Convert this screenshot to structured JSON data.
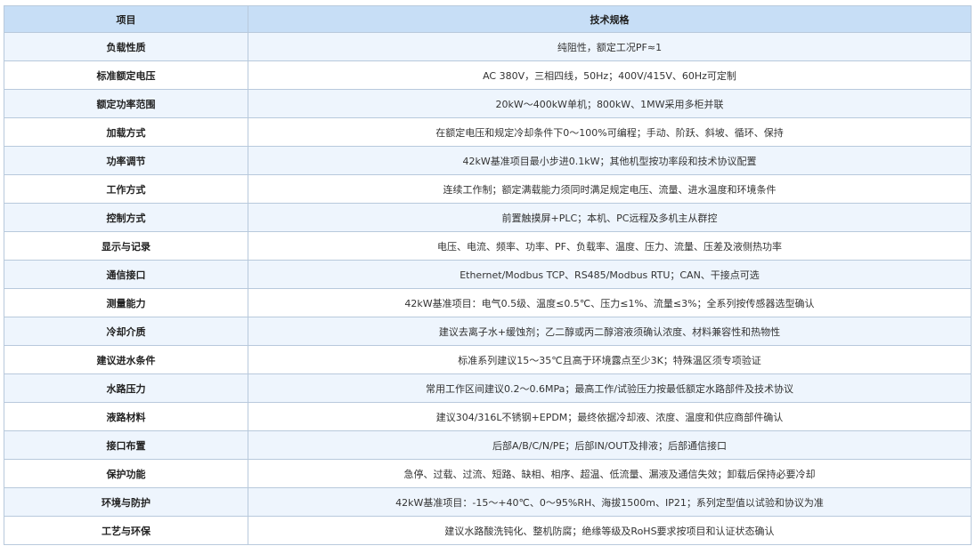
{
  "table": {
    "headers": [
      "项目",
      "技术规格"
    ],
    "rows": [
      {
        "item": "负载性质",
        "spec": "纯阻性，额定工况PF≈1"
      },
      {
        "item": "标准额定电压",
        "spec": "AC 380V，三相四线，50Hz；400V/415V、60Hz可定制"
      },
      {
        "item": "额定功率范围",
        "spec": "20kW～400kW单机；800kW、1MW采用多柜并联"
      },
      {
        "item": "加载方式",
        "spec": "在额定电压和规定冷却条件下0～100%可编程；手动、阶跃、斜坡、循环、保持"
      },
      {
        "item": "功率调节",
        "spec": "42kW基准项目最小步进0.1kW；其他机型按功率段和技术协议配置"
      },
      {
        "item": "工作方式",
        "spec": "连续工作制；额定满载能力须同时满足规定电压、流量、进水温度和环境条件"
      },
      {
        "item": "控制方式",
        "spec": "前置触摸屏+PLC；本机、PC远程及多机主从群控"
      },
      {
        "item": "显示与记录",
        "spec": "电压、电流、频率、功率、PF、负载率、温度、压力、流量、压差及液侧热功率"
      },
      {
        "item": "通信接口",
        "spec": "Ethernet/Modbus TCP、RS485/Modbus RTU；CAN、干接点可选"
      },
      {
        "item": "测量能力",
        "spec": "42kW基准项目：电气0.5级、温度≤0.5℃、压力≤1%、流量≤3%；全系列按传感器选型确认"
      },
      {
        "item": "冷却介质",
        "spec": "建议去离子水+缓蚀剂；乙二醇或丙二醇溶液须确认浓度、材料兼容性和热物性"
      },
      {
        "item": "建议进水条件",
        "spec": "标准系列建议15～35℃且高于环境露点至少3K；特殊温区须专项验证"
      },
      {
        "item": "水路压力",
        "spec": "常用工作区间建议0.2～0.6MPa；最高工作/试验压力按最低额定水路部件及技术协议"
      },
      {
        "item": "液路材料",
        "spec": "建议304/316L不锈钢+EPDM；最终依据冷却液、浓度、温度和供应商部件确认"
      },
      {
        "item": "接口布置",
        "spec": "后部A/B/C/N/PE；后部IN/OUT及排液；后部通信接口"
      },
      {
        "item": "保护功能",
        "spec": "急停、过载、过流、短路、缺相、相序、超温、低流量、漏液及通信失效；卸载后保持必要冷却"
      },
      {
        "item": "环境与防护",
        "spec": "42kW基准项目：-15～+40℃、0～95%RH、海拔1500m、IP21；系列定型值以试验和协议为准"
      },
      {
        "item": "工艺与环保",
        "spec": "建议水路酸洗钝化、整机防腐；绝缘等级及RoHS要求按项目和认证状态确认"
      }
    ]
  }
}
